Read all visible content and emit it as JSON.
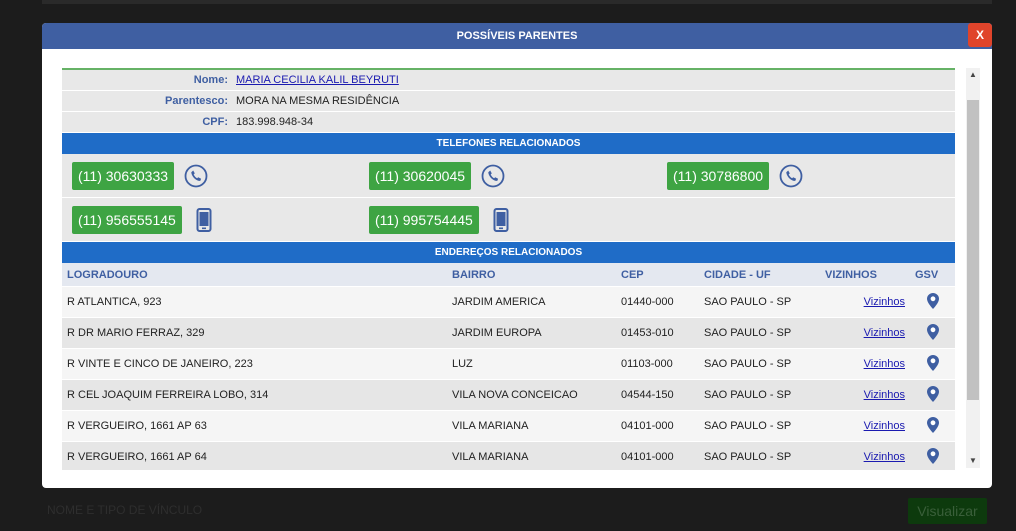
{
  "background": {
    "footer_label": "NOME E TIPO DE VÍNCULO",
    "footer_button": "Visualizar"
  },
  "modal": {
    "title": "POSSÍVEIS PARENTES",
    "close_label": "X"
  },
  "person": {
    "name_label": "Nome:",
    "name": "MARIA CECILIA KALIL BEYRUTI",
    "relation_label": "Parentesco:",
    "relation": "MORA NA MESMA RESIDÊNCIA",
    "cpf_label": "CPF:",
    "cpf": "183.998.948-34"
  },
  "phones": {
    "title": "TELEFONES RELACIONADOS",
    "landlines": [
      "(11) 30630333",
      "(11) 30620045",
      "(11) 30786800"
    ],
    "mobiles": [
      "(11) 956555145",
      "(11) 995754445"
    ]
  },
  "addresses": {
    "title": "ENDEREÇOS RELACIONADOS",
    "headers": [
      "LOGRADOURO",
      "BAIRRO",
      "CEP",
      "CIDADE - UF",
      "VIZINHOS",
      "GSV"
    ],
    "rows": [
      {
        "street": "R ATLANTICA, 923",
        "district": "JARDIM AMERICA",
        "cep": "01440-000",
        "city": "SAO PAULO - SP",
        "neighbors": "Vizinhos"
      },
      {
        "street": "R DR MARIO FERRAZ, 329",
        "district": "JARDIM EUROPA",
        "cep": "01453-010",
        "city": "SAO PAULO - SP",
        "neighbors": "Vizinhos"
      },
      {
        "street": "R VINTE E CINCO DE JANEIRO, 223",
        "district": "LUZ",
        "cep": "01103-000",
        "city": "SAO PAULO - SP",
        "neighbors": "Vizinhos"
      },
      {
        "street": "R CEL JOAQUIM FERREIRA LOBO, 314",
        "district": "VILA NOVA CONCEICAO",
        "cep": "04544-150",
        "city": "SAO PAULO - SP",
        "neighbors": "Vizinhos"
      },
      {
        "street": "R VERGUEIRO, 1661 AP 63",
        "district": "VILA MARIANA",
        "cep": "04101-000",
        "city": "SAO PAULO - SP",
        "neighbors": "Vizinhos"
      },
      {
        "street": "R VERGUEIRO, 1661 AP 64",
        "district": "VILA MARIANA",
        "cep": "04101-000",
        "city": "SAO PAULO - SP",
        "neighbors": "Vizinhos"
      }
    ]
  },
  "icons": {
    "landline": "phone-handset-icon",
    "mobile": "mobile-phone-icon",
    "gsv": "map-pin-icon",
    "scroll_up": "scroll-up-arrow-icon",
    "scroll_down": "scroll-down-arrow-icon"
  },
  "colors": {
    "header_blue": "#3f5fa2",
    "section_blue": "#1f6cc7",
    "phone_green": "#3ea443",
    "close_red": "#e0442b",
    "link_blue": "#1a1ab0"
  }
}
